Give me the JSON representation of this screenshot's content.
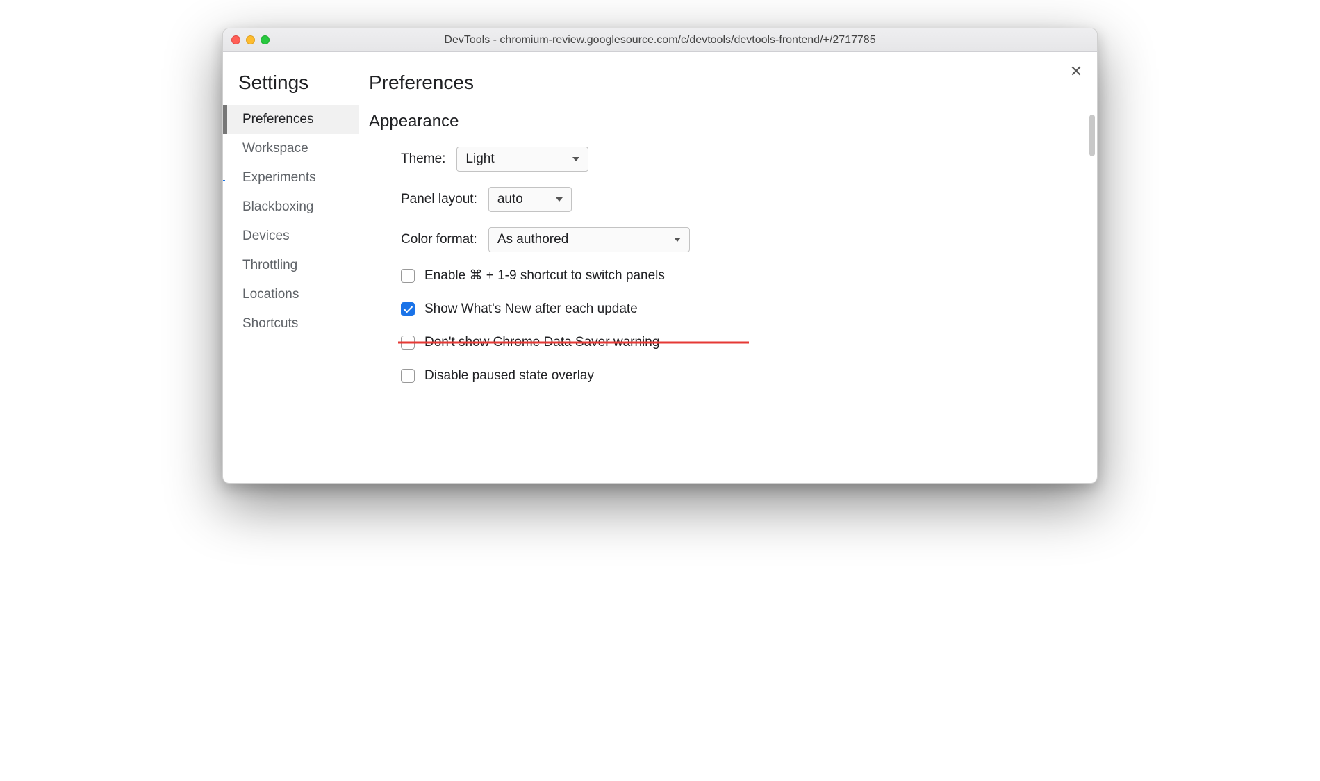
{
  "window": {
    "title": "DevTools - chromium-review.googlesource.com/c/devtools/devtools-frontend/+/2717785"
  },
  "sidebar": {
    "title": "Settings",
    "items": [
      {
        "label": "Preferences",
        "active": true
      },
      {
        "label": "Workspace"
      },
      {
        "label": "Experiments"
      },
      {
        "label": "Blackboxing"
      },
      {
        "label": "Devices"
      },
      {
        "label": "Throttling"
      },
      {
        "label": "Locations"
      },
      {
        "label": "Shortcuts"
      }
    ]
  },
  "main": {
    "title": "Preferences",
    "section": "Appearance",
    "theme_label": "Theme:",
    "theme_value": "Light",
    "panel_layout_label": "Panel layout:",
    "panel_layout_value": "auto",
    "color_format_label": "Color format:",
    "color_format_value": "As authored",
    "checks": [
      {
        "label": "Enable ⌘ + 1-9 shortcut to switch panels",
        "checked": false,
        "struck": false
      },
      {
        "label": "Show What's New after each update",
        "checked": true,
        "struck": false
      },
      {
        "label": "Don't show Chrome Data Saver warning",
        "checked": false,
        "struck": true
      },
      {
        "label": "Disable paused state overlay",
        "checked": false,
        "struck": false
      }
    ]
  }
}
